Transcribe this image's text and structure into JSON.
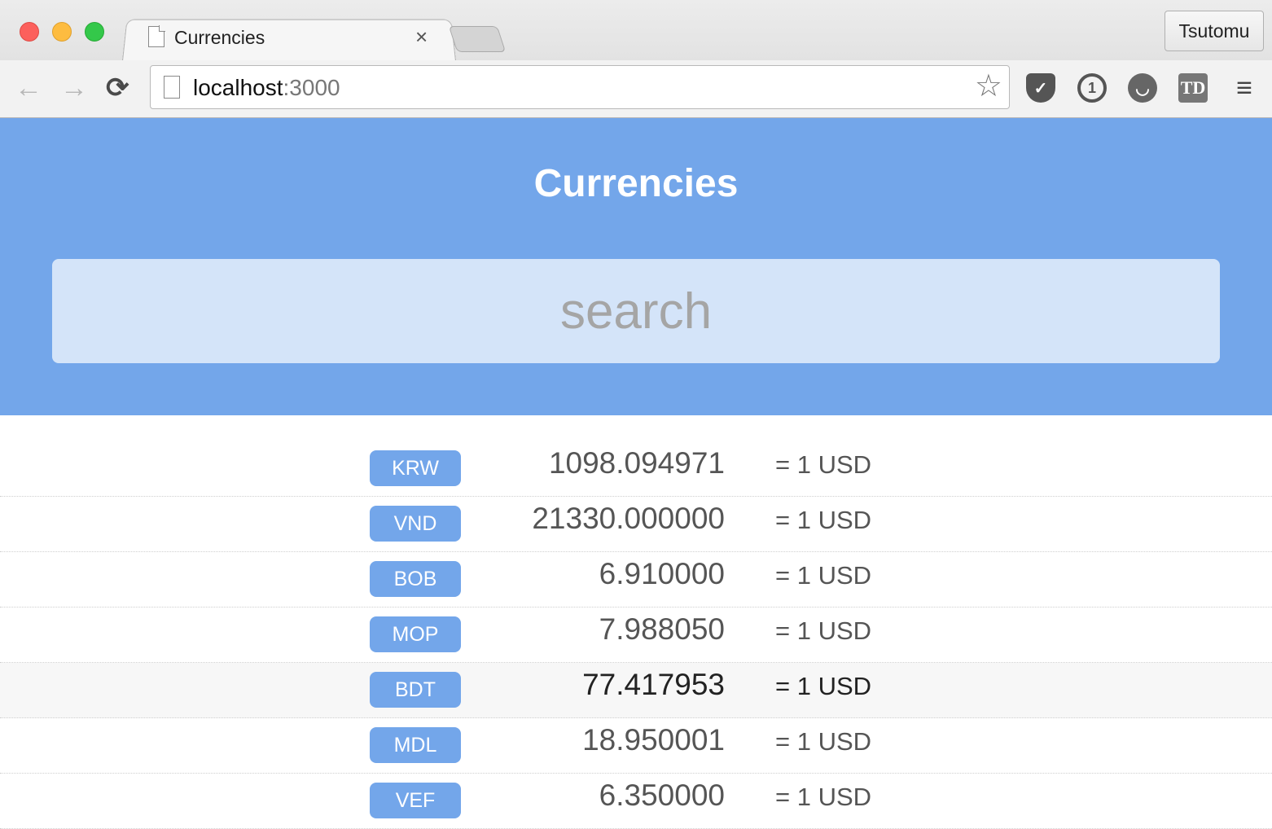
{
  "browser": {
    "tab_title": "Currencies",
    "tab_close": "×",
    "profile": "Tsutomu",
    "url_host": "localhost",
    "url_port": ":3000",
    "nav": {
      "back": "←",
      "forward": "→",
      "reload": "⟳"
    },
    "star": "☆",
    "extensions": [
      {
        "icon": "pocket-icon",
        "glyph": "✓"
      },
      {
        "icon": "onepassword-icon",
        "glyph": "1"
      },
      {
        "icon": "face-icon",
        "glyph": "◡"
      },
      {
        "icon": "tweetdeck-icon",
        "glyph": "TD"
      }
    ],
    "menu": "≡"
  },
  "header": {
    "title": "Currencies",
    "search_placeholder": "search"
  },
  "currencies": [
    {
      "code": "KRW",
      "rate": "1098.094971",
      "suffix": "= 1 USD"
    },
    {
      "code": "VND",
      "rate": "21330.000000",
      "suffix": "= 1 USD"
    },
    {
      "code": "BOB",
      "rate": "6.910000",
      "suffix": "= 1 USD"
    },
    {
      "code": "MOP",
      "rate": "7.988050",
      "suffix": "= 1 USD"
    },
    {
      "code": "BDT",
      "rate": "77.417953",
      "suffix": "= 1 USD"
    },
    {
      "code": "MDL",
      "rate": "18.950001",
      "suffix": "= 1 USD"
    },
    {
      "code": "VEF",
      "rate": "6.350000",
      "suffix": "= 1 USD"
    }
  ],
  "colors": {
    "header_bg": "#73a6ea",
    "badge_bg": "#73a6ea",
    "search_bg": "#d4e4f9"
  }
}
